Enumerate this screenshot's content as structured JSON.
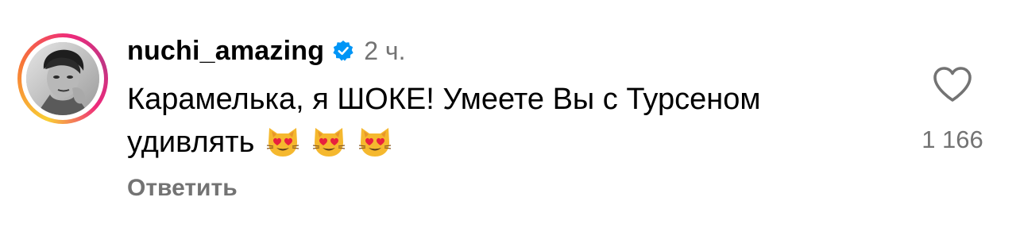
{
  "comment": {
    "username": "nuchi_amazing",
    "verified_icon": "verified-badge-icon",
    "time": "2 ч.",
    "text_line1": "Карамелька, я ШОКЕ! Умеете Вы с Турсеном",
    "text_line2": "удивлять",
    "emojis": [
      "heart-eyes-cat-emoji",
      "heart-eyes-cat-emoji",
      "heart-eyes-cat-emoji"
    ],
    "reply_label": "Ответить",
    "like_icon": "heart-outline-icon",
    "like_count": "1 166"
  },
  "colors": {
    "secondary_text": "#737373",
    "verified_blue": "#0095f6",
    "story_ring": [
      "#f9ce34",
      "#ee2a7b",
      "#c13584"
    ]
  }
}
